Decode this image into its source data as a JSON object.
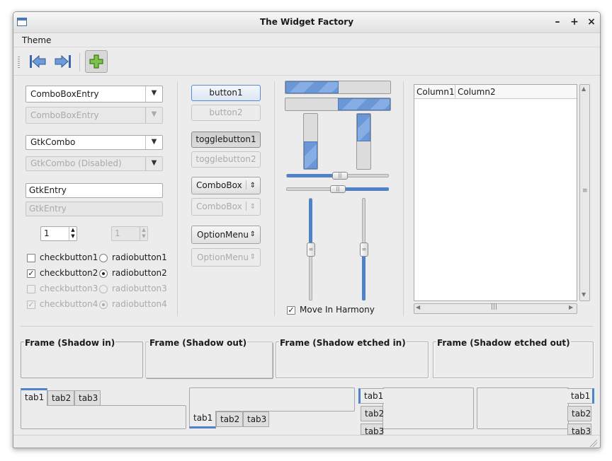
{
  "window": {
    "title": "The Widget Factory",
    "controls": [
      "–",
      "+",
      "×"
    ]
  },
  "menu": {
    "theme": "Theme"
  },
  "toolbar": {
    "icons": [
      "go-first-icon",
      "go-last-icon",
      "add-icon"
    ]
  },
  "left": {
    "comboboxentry": "ComboBoxEntry",
    "comboboxentry_disabled": "ComboBoxEntry",
    "gtkcombo": "GtkCombo",
    "gtkcombo_disabled": "GtkCombo (Disabled)",
    "gtkentry": "GtkEntry",
    "gtkentry_disabled": "GtkEntry",
    "spin1": "1",
    "spin2": "1",
    "check1": "checkbutton1",
    "check2": "checkbutton2",
    "check3": "checkbutton3",
    "check4": "checkbutton4",
    "radio1": "radiobutton1",
    "radio2": "radiobutton2",
    "radio3": "radiobutton3",
    "radio4": "radiobutton4"
  },
  "middle": {
    "button1": "button1",
    "button2": "button2",
    "toggle1": "togglebutton1",
    "toggle2": "togglebutton2",
    "combobox": "ComboBox",
    "combobox_disabled": "ComboBox",
    "optionmenu": "OptionMenu",
    "optionmenu_disabled": "OptionMenu"
  },
  "sliders": {
    "move_in_harmony": "Move In Harmony"
  },
  "tree": {
    "column1": "Column1",
    "column2": "Column2"
  },
  "frames": {
    "shadow_in": "Frame (Shadow in)",
    "shadow_out": "Frame (Shadow out)",
    "shadow_etched_in": "Frame (Shadow etched in)",
    "shadow_etched_out": "Frame (Shadow etched out)"
  },
  "tabs": {
    "tab1": "tab1",
    "tab2": "tab2",
    "tab3": "tab3"
  },
  "colors": {
    "accent": "#4f82c8",
    "window_bg": "#ececec"
  }
}
